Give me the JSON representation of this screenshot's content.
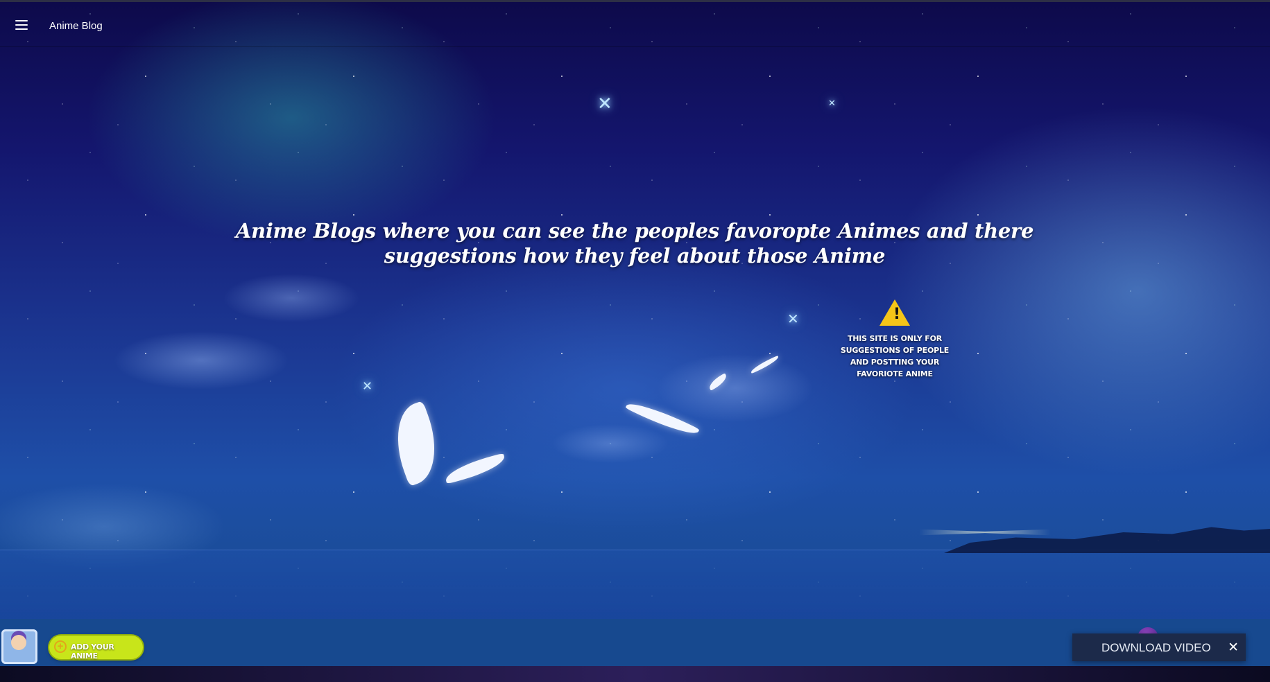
{
  "header": {
    "menu_icon": "hamburger-menu-icon",
    "title": "Anime Blog"
  },
  "hero": {
    "headline": "Anime Blogs where you can see the peoples favoropte Animes and there suggestions how they feel about those Anime"
  },
  "notice": {
    "icon": "warning-icon",
    "icon_glyph": "!",
    "text": "This site is only for suggestions of people and postting your favoriote anime"
  },
  "bottom_bar": {
    "add_button_label": "Add your Anime",
    "add_icon_glyph": "+",
    "download_label": "DOWNLOAD VIDEO",
    "close_glyph": "✕"
  },
  "colors": {
    "sky_top": "#0d0a4a",
    "sky_bottom": "#1e4fa8",
    "bottom_bar": "#17498f",
    "add_button": "#c8e51a",
    "warning": "#f5c518"
  }
}
